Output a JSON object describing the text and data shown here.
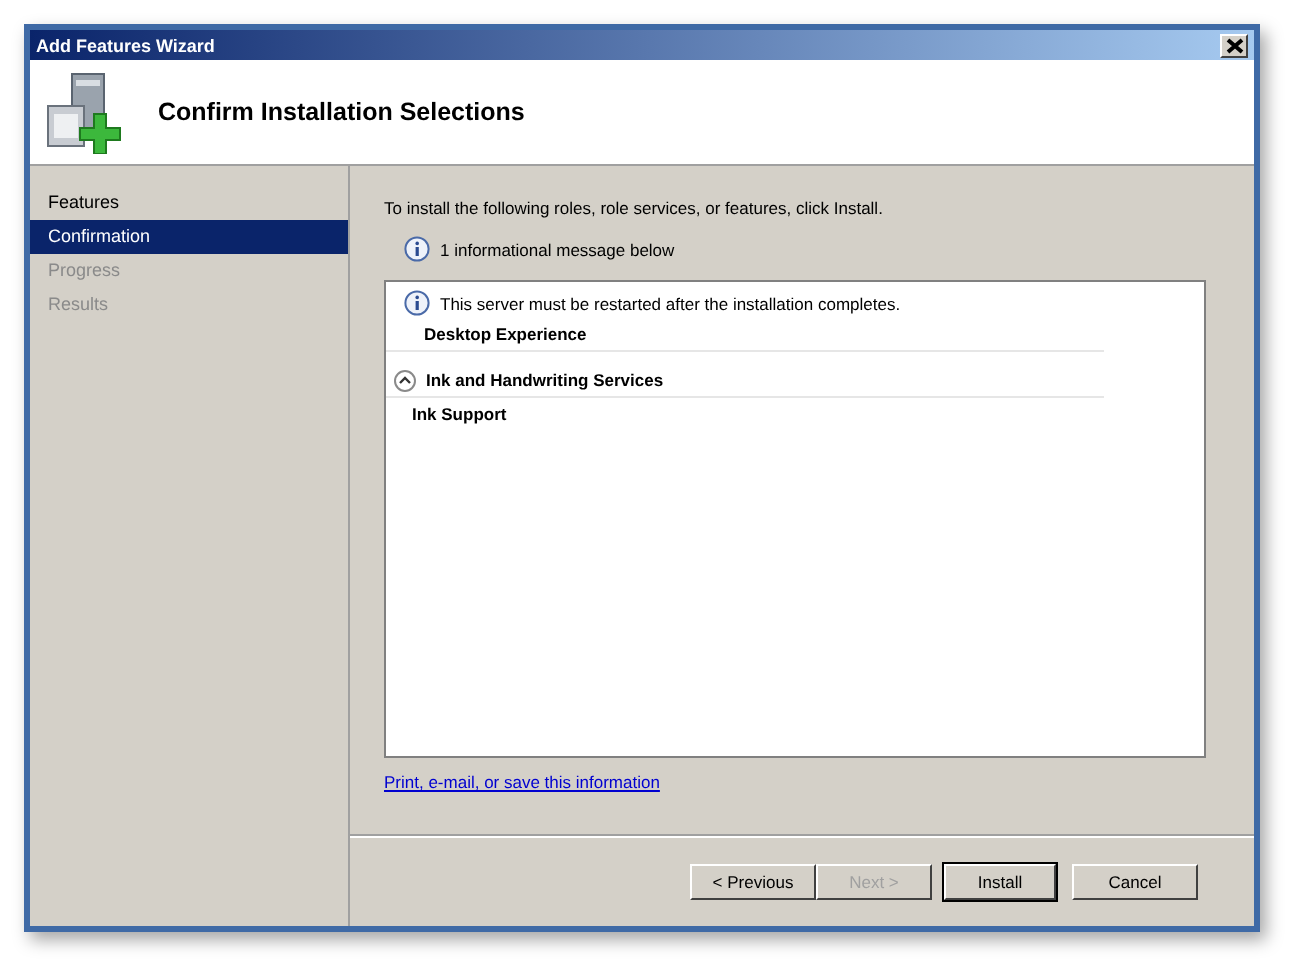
{
  "window": {
    "title": "Add Features Wizard"
  },
  "header": {
    "title": "Confirm Installation Selections"
  },
  "steps": [
    {
      "label": "Features",
      "selected": false,
      "disabled": false
    },
    {
      "label": "Confirmation",
      "selected": true,
      "disabled": false
    },
    {
      "label": "Progress",
      "selected": false,
      "disabled": true
    },
    {
      "label": "Results",
      "selected": false,
      "disabled": true
    }
  ],
  "intro": "To install the following roles, role services, or features, click Install.",
  "info_summary": "1 informational message below",
  "selections": [
    {
      "kind": "message",
      "text": "This server must be restarted after the installation completes."
    },
    {
      "kind": "feature",
      "text": "Desktop Experience"
    },
    {
      "kind": "group",
      "text": "Ink and Handwriting Services",
      "expanded": true
    },
    {
      "kind": "feature",
      "text": "Ink Support"
    }
  ],
  "link": "Print, e-mail, or save this information",
  "buttons": [
    {
      "label": "< Previous",
      "disabled": false,
      "default": false
    },
    {
      "label": "Next >",
      "disabled": true,
      "default": false
    },
    {
      "label": "Install",
      "disabled": false,
      "default": true
    },
    {
      "label": "Cancel",
      "disabled": false,
      "default": false
    }
  ]
}
